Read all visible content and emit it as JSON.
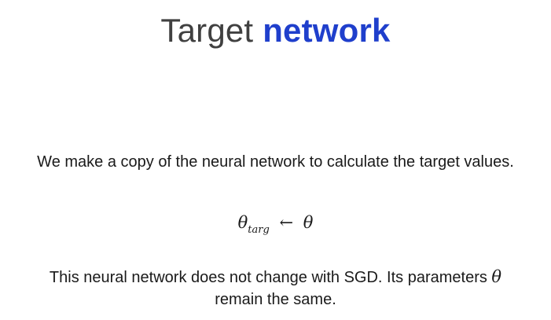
{
  "slide": {
    "title": {
      "plain": "Target",
      "accent": "network"
    },
    "intro_text": "We make a copy of the neural network to calculate the target values.",
    "formula": {
      "lhs": "θ",
      "lhs_subscript": "targ",
      "arrow": "←",
      "rhs": "θ"
    },
    "note": {
      "before_symbol": "This neural network does not change with SGD. Its parameters",
      "symbol": "θ",
      "after_symbol": "remain the same."
    }
  },
  "colors": {
    "title_plain": "#404040",
    "title_accent": "#1f3fcc",
    "body_text": "#1a1a1a",
    "background": "#ffffff"
  }
}
